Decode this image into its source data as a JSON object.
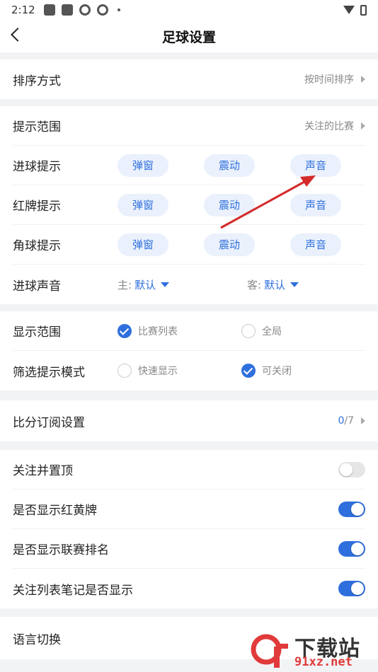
{
  "status_bar": {
    "time": "2:12"
  },
  "header": {
    "title": "足球设置"
  },
  "sort_section": {
    "label": "排序方式",
    "value": "按时间排序"
  },
  "alert_section": {
    "range_label": "提示范围",
    "range_value": "关注的比赛",
    "rows": [
      {
        "label": "进球提示",
        "options": [
          "弹窗",
          "震动",
          "声音"
        ]
      },
      {
        "label": "红牌提示",
        "options": [
          "弹窗",
          "震动",
          "声音"
        ]
      },
      {
        "label": "角球提示",
        "options": [
          "弹窗",
          "震动",
          "声音"
        ]
      }
    ],
    "goal_sound": {
      "label": "进球声音",
      "home_key": "主:",
      "home_value": "默认",
      "away_key": "客:",
      "away_value": "默认"
    }
  },
  "display_section": {
    "range_label": "显示范围",
    "range_options": [
      {
        "label": "比赛列表",
        "checked": true
      },
      {
        "label": "全局",
        "checked": false
      }
    ],
    "filter_label": "筛选提示模式",
    "filter_options": [
      {
        "label": "快速显示",
        "checked": false
      },
      {
        "label": "可关闭",
        "checked": true
      }
    ]
  },
  "score_section": {
    "label": "比分订阅设置",
    "count_current": "0",
    "count_total": "/7"
  },
  "toggle_section": {
    "items": [
      {
        "label": "关注并置顶",
        "on": false
      },
      {
        "label": "是否显示红黄牌",
        "on": true
      },
      {
        "label": "是否显示联赛排名",
        "on": true
      },
      {
        "label": "关注列表笔记是否显示",
        "on": true
      }
    ]
  },
  "language_section": {
    "label": "语言切换"
  },
  "watermark": {
    "logo": "9f",
    "top": "下载站",
    "bottom": "91xz.net"
  },
  "colors": {
    "accent": "#2f6fdd",
    "pill_bg": "#eaf1fc",
    "arrow": "#d42a2a"
  }
}
